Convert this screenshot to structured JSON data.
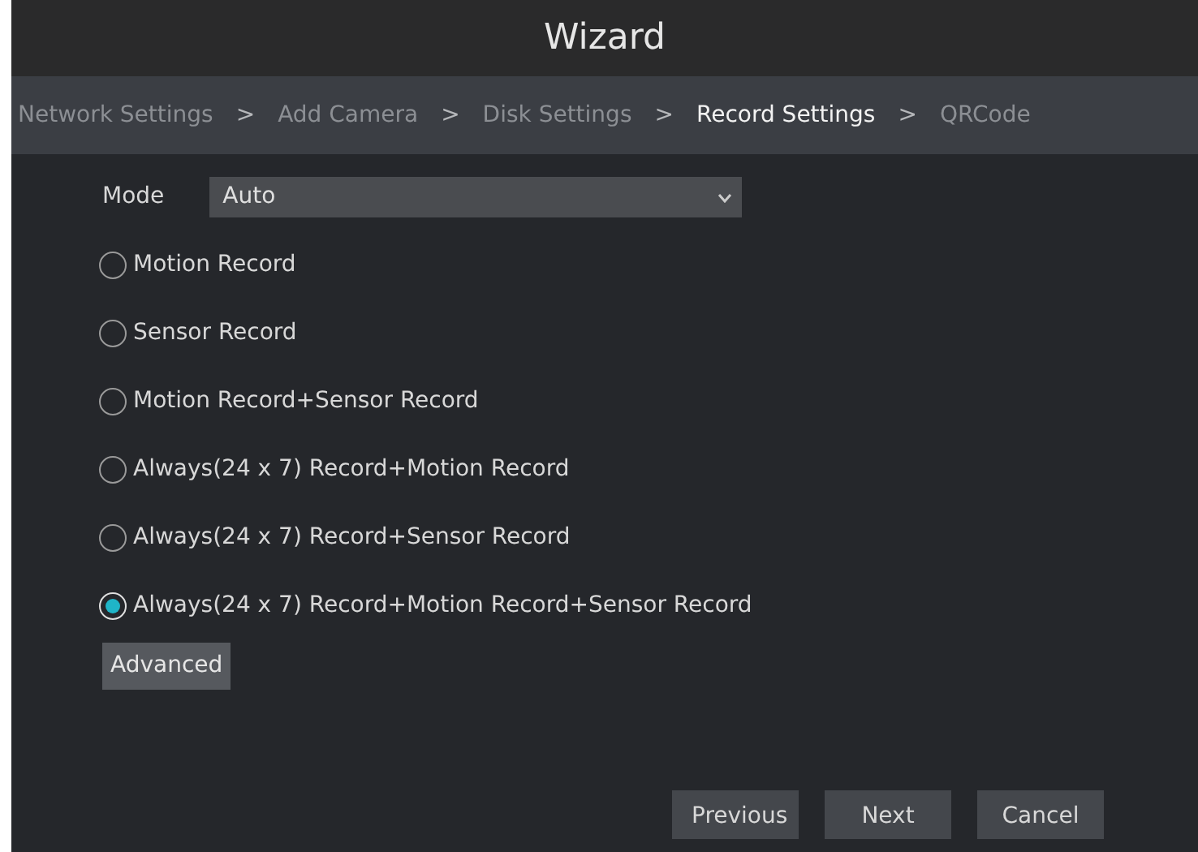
{
  "window": {
    "title": "Wizard"
  },
  "steps": [
    {
      "label": "Network Settings",
      "selected": false,
      "separator": ">"
    },
    {
      "label": "Add Camera",
      "selected": false,
      "separator": ">"
    },
    {
      "label": "Disk Settings",
      "selected": false,
      "separator": ">"
    },
    {
      "label": "Record Settings",
      "selected": true,
      "separator": ">"
    },
    {
      "label": "QRCode",
      "selected": false
    }
  ],
  "mode": {
    "label": "Mode",
    "value": "Auto"
  },
  "options": [
    {
      "label": "Motion Record",
      "selected": false
    },
    {
      "label": "Sensor Record",
      "selected": false
    },
    {
      "label": "Motion Record+Sensor Record",
      "selected": false
    },
    {
      "label": "Always(24 x 7) Record+Motion Record",
      "selected": false
    },
    {
      "label": "Always(24 x 7) Record+Sensor Record",
      "selected": false
    },
    {
      "label": "Always(24 x 7) Record+Motion Record+Sensor Record",
      "selected": true
    }
  ],
  "advanced_button": "Advanced",
  "buttons": [
    "Previous",
    "Next",
    "Cancel"
  ]
}
